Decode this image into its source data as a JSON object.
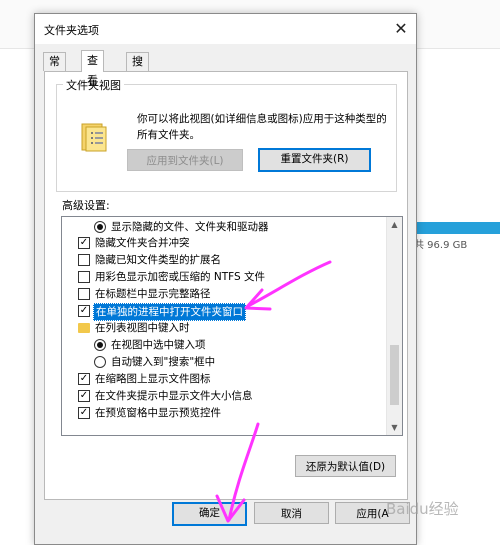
{
  "background": {
    "drive_text": "共 96.9 GB"
  },
  "dialog": {
    "title": "文件夹选项",
    "close_glyph": "✕",
    "tabs": [
      {
        "label": "常规"
      },
      {
        "label": "查看",
        "active": true
      },
      {
        "label": "搜索"
      }
    ],
    "folder_views": {
      "label": "文件夹视图",
      "description": "你可以将此视图(如详细信息或图标)应用于这种类型的所有文件夹。",
      "apply_button": "应用到文件夹(L)",
      "apply_disabled": true,
      "reset_button": "重置文件夹(R)"
    },
    "advanced_label": "高级设置:",
    "advanced_items": [
      {
        "type": "radio",
        "checked": true,
        "label": "显示隐藏的文件、文件夹和驱动器"
      },
      {
        "type": "checkbox",
        "checked": true,
        "label": "隐藏文件夹合并冲突"
      },
      {
        "type": "checkbox",
        "checked": false,
        "label": "隐藏已知文件类型的扩展名"
      },
      {
        "type": "checkbox",
        "checked": false,
        "label": "用彩色显示加密或压缩的 NTFS 文件"
      },
      {
        "type": "checkbox",
        "checked": false,
        "label": "在标题栏中显示完整路径"
      },
      {
        "type": "checkbox",
        "checked": true,
        "label": "在单独的进程中打开文件夹窗口",
        "selected": true
      },
      {
        "type": "folder",
        "label": "在列表视图中键入时"
      },
      {
        "type": "radio",
        "checked": true,
        "label": "在视图中选中键入项"
      },
      {
        "type": "radio",
        "checked": false,
        "label": "自动键入到\"搜索\"框中"
      },
      {
        "type": "checkbox",
        "checked": true,
        "label": "在缩略图上显示文件图标"
      },
      {
        "type": "checkbox",
        "checked": true,
        "label": "在文件夹提示中显示文件大小信息"
      },
      {
        "type": "checkbox",
        "checked": true,
        "label": "在预览窗格中显示预览控件"
      }
    ],
    "restore_button": "还原为默认值(D)",
    "footer": {
      "ok": "确定",
      "cancel": "取消",
      "apply": "应用(A"
    }
  },
  "watermark": "Baidu经验",
  "colors": {
    "selection": "#0078d7",
    "annotation_arrow": "#ff33ff",
    "drive_bar": "#26a0da"
  }
}
